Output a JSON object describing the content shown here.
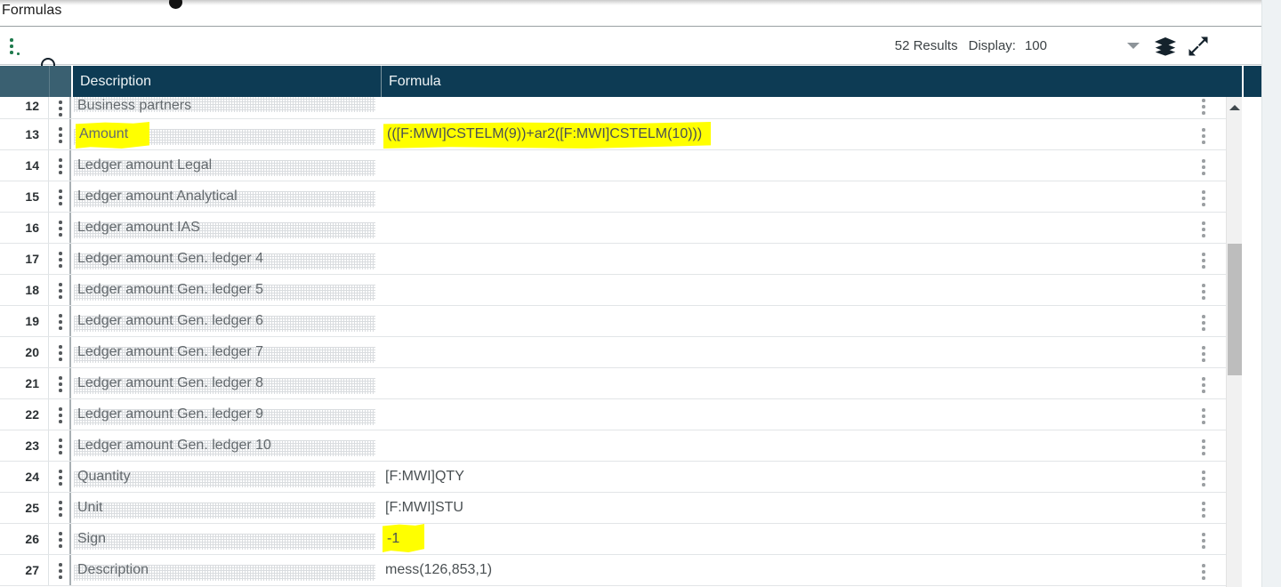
{
  "page": {
    "title": "Formulas"
  },
  "toolbar": {
    "menu_icon": "kebab-menu-icon",
    "search_icon": "search-icon",
    "results_label": "52 Results",
    "display_label": "Display:",
    "display_value": "100",
    "dropdown_icon": "chevron-down-icon",
    "layers_icon": "layers-icon",
    "expand_icon": "expand-arrows-icon"
  },
  "grid": {
    "columns": [
      {
        "key": "rownum",
        "label": ""
      },
      {
        "key": "menu",
        "label": ""
      },
      {
        "key": "description",
        "label": "Description"
      },
      {
        "key": "formula",
        "label": "Formula"
      }
    ],
    "rows": [
      {
        "num": "12",
        "description": "Business partners",
        "formula": "",
        "desc_highlight": false,
        "formula_highlight": false,
        "clipped": true
      },
      {
        "num": "13",
        "description": "Amount",
        "formula": "(([F:MWI]CSTELM(9))+ar2([F:MWI]CSTELM(10)))",
        "desc_highlight": true,
        "formula_highlight": true,
        "clipped": false
      },
      {
        "num": "14",
        "description": "Ledger amount Legal",
        "formula": "",
        "desc_highlight": false,
        "formula_highlight": false,
        "clipped": false
      },
      {
        "num": "15",
        "description": "Ledger amount Analytical",
        "formula": "",
        "desc_highlight": false,
        "formula_highlight": false,
        "clipped": false
      },
      {
        "num": "16",
        "description": "Ledger amount IAS",
        "formula": "",
        "desc_highlight": false,
        "formula_highlight": false,
        "clipped": false
      },
      {
        "num": "17",
        "description": "Ledger amount Gen. ledger 4",
        "formula": "",
        "desc_highlight": false,
        "formula_highlight": false,
        "clipped": false
      },
      {
        "num": "18",
        "description": "Ledger amount Gen. ledger 5",
        "formula": "",
        "desc_highlight": false,
        "formula_highlight": false,
        "clipped": false
      },
      {
        "num": "19",
        "description": "Ledger amount Gen. ledger 6",
        "formula": "",
        "desc_highlight": false,
        "formula_highlight": false,
        "clipped": false
      },
      {
        "num": "20",
        "description": "Ledger amount Gen. ledger 7",
        "formula": "",
        "desc_highlight": false,
        "formula_highlight": false,
        "clipped": false
      },
      {
        "num": "21",
        "description": "Ledger amount Gen. ledger 8",
        "formula": "",
        "desc_highlight": false,
        "formula_highlight": false,
        "clipped": false
      },
      {
        "num": "22",
        "description": "Ledger amount Gen. ledger 9",
        "formula": "",
        "desc_highlight": false,
        "formula_highlight": false,
        "clipped": false
      },
      {
        "num": "23",
        "description": "Ledger amount Gen. ledger 10",
        "formula": "",
        "desc_highlight": false,
        "formula_highlight": false,
        "clipped": false
      },
      {
        "num": "24",
        "description": "Quantity",
        "formula": "[F:MWI]QTY",
        "desc_highlight": false,
        "formula_highlight": false,
        "clipped": false
      },
      {
        "num": "25",
        "description": "Unit",
        "formula": "[F:MWI]STU",
        "desc_highlight": false,
        "formula_highlight": false,
        "clipped": false
      },
      {
        "num": "26",
        "description": "Sign",
        "formula": "-1",
        "desc_highlight": false,
        "formula_highlight": true,
        "clipped": false
      },
      {
        "num": "27",
        "description": "Description",
        "formula": "mess(126,853,1)",
        "desc_highlight": false,
        "formula_highlight": false,
        "clipped": false
      }
    ]
  },
  "scrollbar": {
    "up_arrow_icon": "caret-up-icon"
  },
  "colors": {
    "header_dark": "#0d3b54",
    "header_light": "#3a6071",
    "highlight": "#ffff00",
    "accent_green": "#1f7a4d"
  }
}
